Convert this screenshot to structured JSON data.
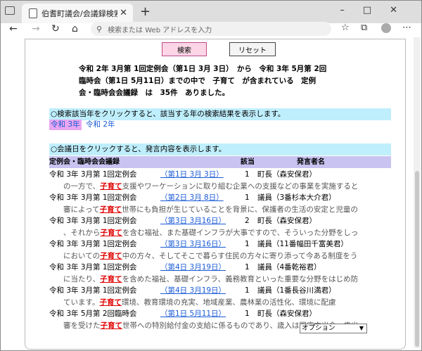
{
  "browser": {
    "tab_title": "伯耆町議会/会議録検索システム",
    "address_placeholder": "検索または Web アドレスを入力"
  },
  "buttons": {
    "search": "検索",
    "reset": "リセット"
  },
  "summary": [
    "令和 2年 3月第 1回定例会（第1日 3月 3日）　から　令和 3年 5月第 2回",
    "臨時会（第1日 5月11日）までの中で　子育て　が含まれている　定例",
    "会・臨時会会議録　は　35件　ありました。"
  ],
  "year_section": {
    "instruction": "○検索該当年をクリックすると、該当する年の検索結果を表示します。",
    "years": [
      "令和 3年",
      "令和 2年"
    ]
  },
  "date_section": {
    "instruction": "○会議日をクリックすると、発言内容を表示します。",
    "columns": {
      "meeting": "定例会・臨時会会議録",
      "seq": "該当",
      "speaker": "発言者名"
    },
    "rows": [
      {
        "meeting": "令和 3年 3月第 1回定例会",
        "date": "（第1日 3月 3日）",
        "num": "1",
        "speaker": "町長（森安保君）",
        "pre": "の一方で、",
        "kw": "子育て",
        "post": "支援やワーケーションに取り組む企業への支援などの事業を実施すると"
      },
      {
        "meeting": "令和 3年 3月第 1回定例会",
        "date": "（第2日 3月 8日）",
        "num": "1",
        "speaker": "議員（3番杉本大介君）",
        "pre": "審によって",
        "kw": "子育て",
        "post": "世帯にも負担が生じていることを背景に、保護者の生活の安定と児童の"
      },
      {
        "meeting": "令和 3年 3月第 1回定例会",
        "date": "（第3日 3月16日）",
        "num": "2",
        "speaker": "町長（森安保君）",
        "pre": "、それから",
        "kw": "子育て",
        "post": "を含む福祉、また基礎インフラが大事ですので、そういった分野をしっ"
      },
      {
        "meeting": "令和 3年 3月第 1回定例会",
        "date": "（第3日 3月16日）",
        "num": "1",
        "speaker": "議員（11番幅田千富美君）",
        "pre": "においての",
        "kw": "子育て",
        "post": "中の方々、そしてそこで暮らす住民の方々に寄り添って今ある制度をう"
      },
      {
        "meeting": "令和 3年 3月第 1回定例会",
        "date": "（第4日 3月19日）",
        "num": "1",
        "speaker": "議員（4番乾裕君）",
        "pre": "に当たり、",
        "kw": "子育て",
        "post": "を含めた福祉、基礎インフラ、義務教育といった重要な分野をはじめ防"
      },
      {
        "meeting": "令和 3年 3月第 1回定例会",
        "date": "（第4日 3月19日）",
        "num": "1",
        "speaker": "議員（1番長谷川満君）",
        "pre": "ています。",
        "kw": "子育て",
        "post": "環境、教育環境の充実、地域産業、農林業の活性化、環境に配慮"
      },
      {
        "meeting": "令和 3年 5月第 2回臨時会",
        "date": "（第1日 5月11日）",
        "num": "1",
        "speaker": "町長（森安保君）",
        "pre": "審を受けた",
        "kw": "子育て",
        "post": "世帯への特別給付金の支給に係るものであり、歳入は国庫支出金、歳出"
      }
    ]
  },
  "option_select": "オプション",
  "colors": {
    "bar_bg": "#bfeefc",
    "header_bg": "#c9c3f1",
    "keyword": "#e00000",
    "link": "#1a5bd6",
    "search_btn": "#fcd6e6",
    "year_selected": "#e9a6f0"
  }
}
